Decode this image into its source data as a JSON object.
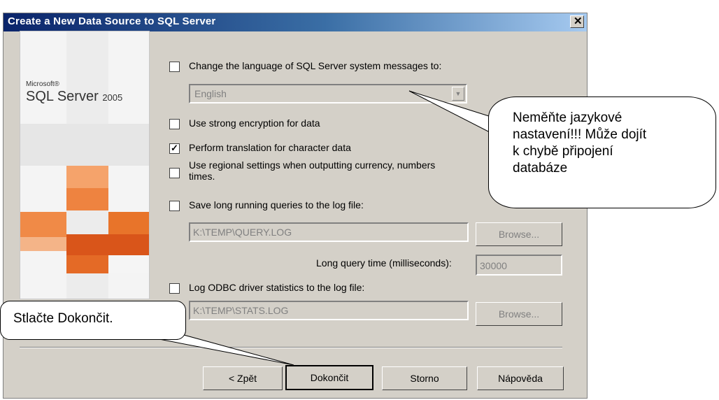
{
  "window": {
    "title": "Create a New Data Source to SQL Server",
    "close_symbol": "✕"
  },
  "banner": {
    "microsoft": "Microsoft®",
    "product": "SQL Server",
    "version": "2005"
  },
  "options": {
    "change_language": {
      "label": "Change the language of SQL Server system messages to:",
      "checked": false
    },
    "language_select": {
      "value": "English"
    },
    "strong_encryption": {
      "label": "Use strong encryption for data",
      "checked": false
    },
    "translation": {
      "label": "Perform translation for character data",
      "checked": true
    },
    "regional": {
      "label_line1": "Use regional settings when outputting currency, numbers",
      "label_line2": "times.",
      "checked": false
    },
    "long_queries": {
      "label": "Save long running queries to the log file:",
      "checked": false
    },
    "query_log_path": "K:\\TEMP\\QUERY.LOG",
    "long_query_time_label": "Long query time (milliseconds):",
    "long_query_time_value": "30000",
    "odbc_stats": {
      "label": "Log ODBC driver statistics to the log file:",
      "checked": false
    },
    "stats_log_path": "K:\\TEMP\\STATS.LOG",
    "browse_label_1": "Browse...",
    "browse_label_2": "Browse..."
  },
  "buttons": {
    "back": "< Zpět",
    "finish": "Dokončit",
    "cancel": "Storno",
    "help": "Nápověda"
  },
  "callouts": {
    "language_warning": [
      "Neměňte jazykové",
      "nastavení!!! Může dojít",
      "k chybě připojení",
      "databáze"
    ],
    "finish_hint": "Stlačte Dokončit."
  },
  "colors": {
    "orange": "#e8742a",
    "dark_orange": "#d9551a",
    "dialog_bg": "#d4d0c8"
  }
}
